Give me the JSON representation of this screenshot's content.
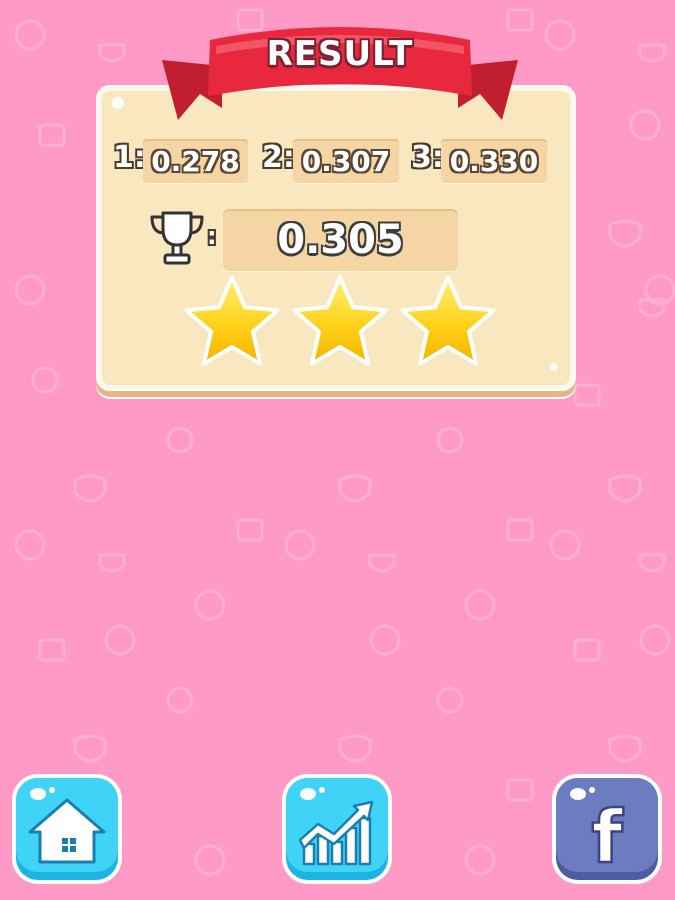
{
  "result": {
    "title": "RESULT",
    "scores": [
      {
        "label": "1:",
        "value": "0.278"
      },
      {
        "label": "2:",
        "value": "0.307"
      },
      {
        "label": "3:",
        "value": "0.330"
      }
    ],
    "best_separator": ":",
    "best_value": "0.305",
    "stars_earned": 3,
    "stars_total": 3
  },
  "buttons": {
    "home_icon": "home-icon",
    "leaderboard_icon": "chart-up-icon",
    "facebook_icon": "facebook-icon",
    "facebook_glyph": "f"
  },
  "colors": {
    "background": "#ff99c6",
    "panel": "#f9e7bf",
    "ribbon": "#e8283c",
    "star": "#ffd21a",
    "home_button": "#2fd0f5",
    "facebook_button": "#6d7bc0"
  }
}
